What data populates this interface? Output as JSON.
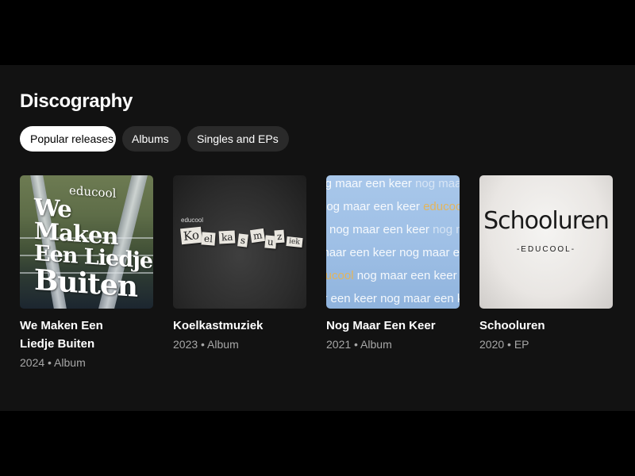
{
  "section": {
    "title": "Discography"
  },
  "filters": [
    {
      "label": "Popular releases",
      "active": true
    },
    {
      "label": "Albums",
      "active": false
    },
    {
      "label": "Singles and EPs",
      "active": false
    }
  ],
  "releases": [
    {
      "title": "We Maken Een Liedje Buiten",
      "meta": "2024 • Album",
      "cover_text": [
        "educool",
        "We Maken",
        "Een Liedje",
        "Buiten"
      ]
    },
    {
      "title": "Koelkastmuziek",
      "meta": "2023 • Album",
      "cover_text": [
        "educool",
        "Ko",
        "el",
        "ka",
        "s",
        "m",
        "u",
        "z",
        "iek"
      ]
    },
    {
      "title": "Nog Maar Een Keer",
      "meta": "2021 • Album",
      "cover_text": [
        "nog maar een keer",
        "educool"
      ]
    },
    {
      "title": "Schooluren",
      "meta": "2020 • EP",
      "cover_text": [
        "Schooluren",
        "-EDUCOOL-"
      ]
    }
  ],
  "colors": {
    "page_background": "#000000",
    "panel_background": "#121212",
    "chip_background": "#2a2a2a",
    "chip_active_background": "#ffffff",
    "meta_text": "#a7a7a7"
  }
}
